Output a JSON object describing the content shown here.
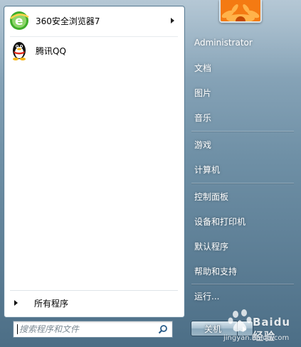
{
  "pinned_programs": [
    {
      "label": "360安全浏览器7",
      "icon": "browser-360-icon",
      "has_submenu": true
    },
    {
      "label": "腾讯QQ",
      "icon": "qq-penguin-icon",
      "has_submenu": false
    }
  ],
  "all_programs_label": "所有程序",
  "search": {
    "placeholder": "搜索程序和文件",
    "value": ""
  },
  "right_menu": [
    {
      "label": "Administrator"
    },
    {
      "label": "文档"
    },
    {
      "label": "图片"
    },
    {
      "label": "音乐"
    },
    {
      "label": "游戏"
    },
    {
      "label": "计算机"
    },
    {
      "label": "控制面板"
    },
    {
      "label": "设备和打印机"
    },
    {
      "label": "默认程序"
    },
    {
      "label": "帮助和支持"
    },
    {
      "label": "运行..."
    }
  ],
  "shutdown": {
    "label": "关机"
  },
  "watermark": {
    "text": "Baidu 经验",
    "sub": "jingyan.baidu.com"
  },
  "colors": {
    "panel_bg": "#ffffff",
    "glass_top": "#9cb5c7",
    "glass_bottom": "#4c6e86",
    "right_text": "#ffffff"
  }
}
